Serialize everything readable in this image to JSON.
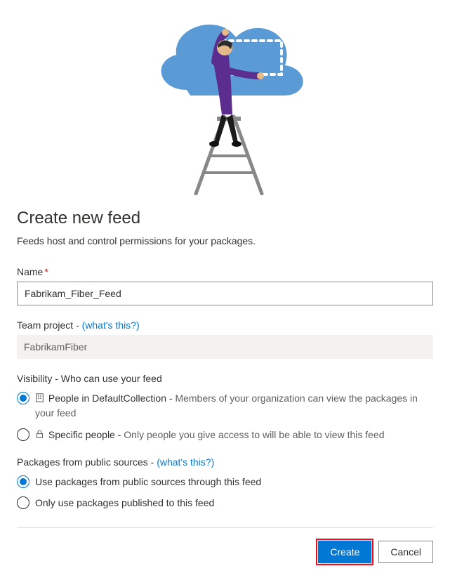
{
  "heading": "Create new feed",
  "subtitle": "Feeds host and control permissions for your packages.",
  "name": {
    "label": "Name",
    "required": "*",
    "value": "Fabrikam_Fiber_Feed"
  },
  "teamProject": {
    "label": "Team project - ",
    "whatsThis": "(what's this?)",
    "value": "FabrikamFiber"
  },
  "visibility": {
    "label": "Visibility - Who can use your feed",
    "options": [
      {
        "checked": true,
        "icon": "collection-icon",
        "lead": "People in DefaultCollection - ",
        "desc": "Members of your organization can view the packages in your feed"
      },
      {
        "checked": false,
        "icon": "lock-icon",
        "lead": "Specific people - ",
        "desc": "Only people you give access to will be able to view this feed"
      }
    ]
  },
  "publicSources": {
    "label": "Packages from public sources - ",
    "whatsThis": "(what's this?)",
    "options": [
      {
        "checked": true,
        "label": "Use packages from public sources through this feed"
      },
      {
        "checked": false,
        "label": "Only use packages published to this feed"
      }
    ]
  },
  "buttons": {
    "create": "Create",
    "cancel": "Cancel"
  }
}
